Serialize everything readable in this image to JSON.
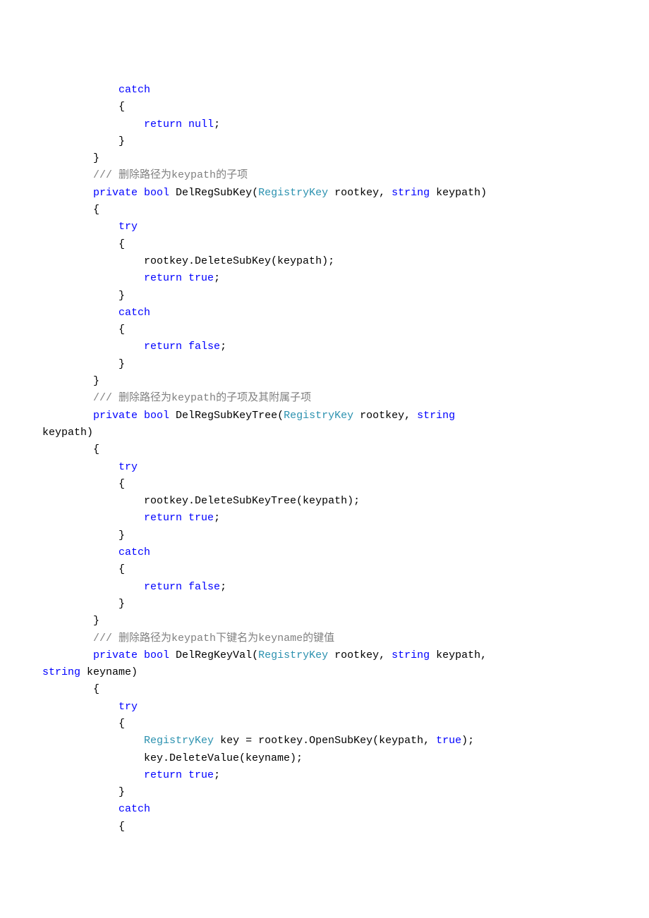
{
  "code": {
    "l1": "            catch",
    "l2": "            {",
    "l3a": "                return ",
    "l3b": "null",
    "l3c": ";",
    "l4": "            }",
    "l5": "        }",
    "l6a": "        /// ",
    "l6b": "删除路径为",
    "l6c": "keypath",
    "l6d": "的子项",
    "l7a": "        private ",
    "l7b": "bool",
    "l7c": " DelRegSubKey(",
    "l7d": "RegistryKey",
    "l7e": " rootkey, ",
    "l7f": "string",
    "l7g": " keypath)",
    "l8": "        {",
    "l9": "            try",
    "l10": "            {",
    "l11": "                rootkey.DeleteSubKey(keypath);",
    "l12a": "                return ",
    "l12b": "true",
    "l12c": ";",
    "l13": "            }",
    "l14": "            catch",
    "l15": "            {",
    "l16a": "                return ",
    "l16b": "false",
    "l16c": ";",
    "l17": "            }",
    "l18": "        }",
    "l19a": "        /// ",
    "l19b": "删除路径为",
    "l19c": "keypath",
    "l19d": "的子项及其附属子项",
    "l20a": "        private ",
    "l20b": "bool",
    "l20c": " DelRegSubKeyTree(",
    "l20d": "RegistryKey",
    "l20e": " rootkey, ",
    "l20f": "string",
    "l20g": " ",
    "l20h": "keypath)",
    "l21": "        {",
    "l22": "            try",
    "l23": "            {",
    "l24": "                rootkey.DeleteSubKeyTree(keypath);",
    "l25a": "                return ",
    "l25b": "true",
    "l25c": ";",
    "l26": "            }",
    "l27": "            catch",
    "l28": "            {",
    "l29a": "                return ",
    "l29b": "false",
    "l29c": ";",
    "l30": "            }",
    "l31": "        }",
    "l32a": "        /// ",
    "l32b": "删除路径为",
    "l32c": "keypath",
    "l32d": "下键名为",
    "l32e": "keyname",
    "l32f": "的键值",
    "l33a": "        private ",
    "l33b": "bool",
    "l33c": " DelRegKeyVal(",
    "l33d": "RegistryKey",
    "l33e": " rootkey, ",
    "l33f": "string",
    "l33g": " keypath, ",
    "l33h": "string",
    "l33i": " keyname)",
    "l34": "        {",
    "l35": "            try",
    "l36": "            {",
    "l37a": "                ",
    "l37b": "RegistryKey",
    "l37c": " key = rootkey.OpenSubKey(keypath, ",
    "l37d": "true",
    "l37e": ");",
    "l38": "                key.DeleteValue(keyname);",
    "l39a": "                return ",
    "l39b": "true",
    "l39c": ";",
    "l40": "            }",
    "l41": "            catch",
    "l42": "            {"
  }
}
